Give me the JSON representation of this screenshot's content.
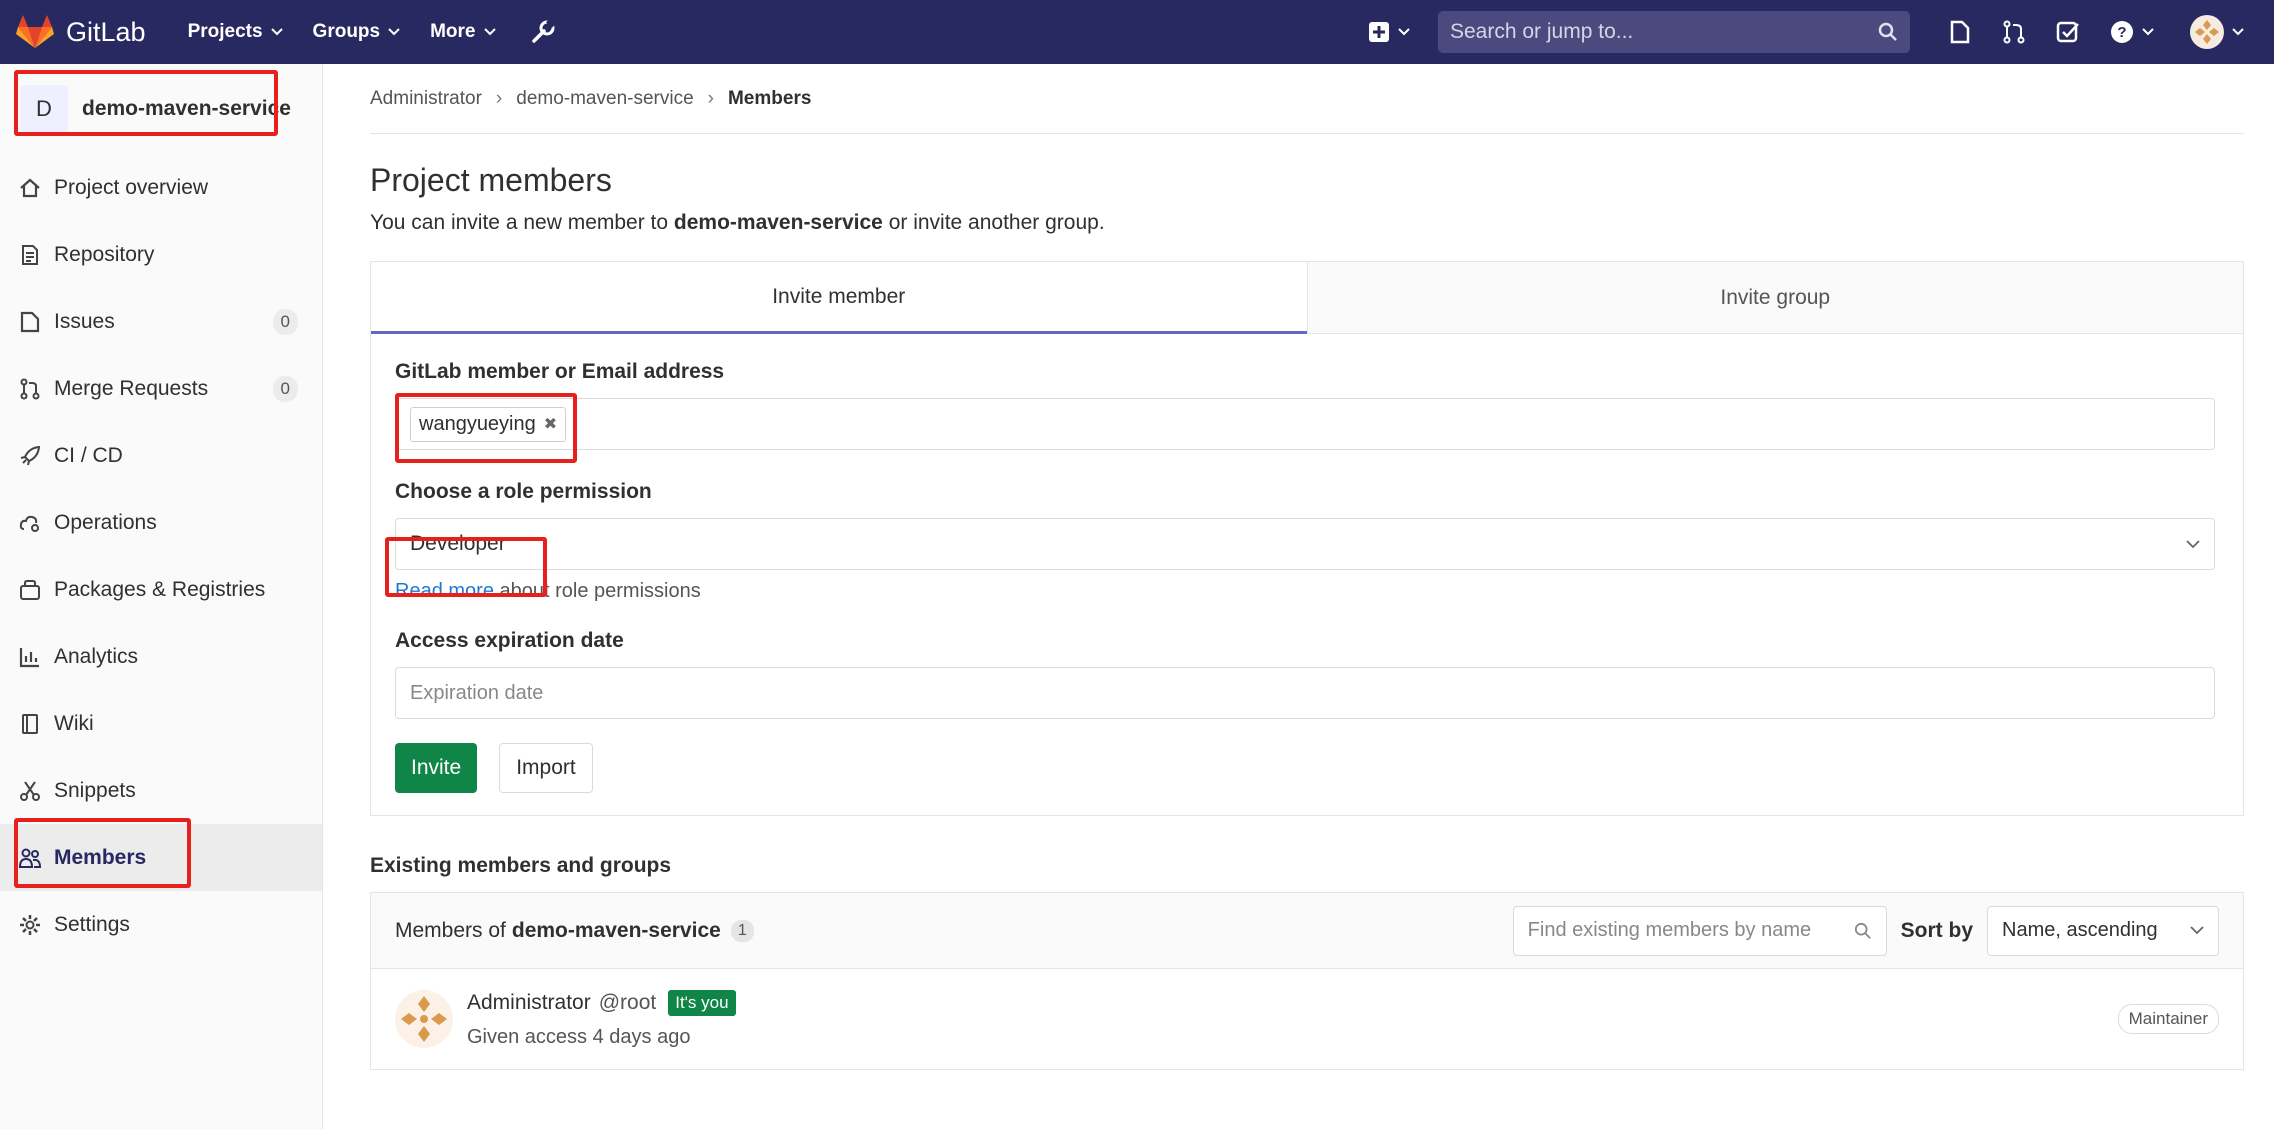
{
  "navbar": {
    "brand": "GitLab",
    "items": [
      {
        "label": "Projects"
      },
      {
        "label": "Groups"
      },
      {
        "label": "More"
      }
    ],
    "search_placeholder": "Search or jump to...",
    "colors": {
      "bg": "#292961",
      "accent": "#e24329"
    }
  },
  "sidebar": {
    "project_initial": "D",
    "project_name": "demo-maven-service",
    "items": [
      {
        "label": "Project overview",
        "icon": "home-icon"
      },
      {
        "label": "Repository",
        "icon": "doc-icon"
      },
      {
        "label": "Issues",
        "icon": "issues-icon",
        "count": "0"
      },
      {
        "label": "Merge Requests",
        "icon": "merge-request-icon",
        "count": "0"
      },
      {
        "label": "CI / CD",
        "icon": "rocket-icon"
      },
      {
        "label": "Operations",
        "icon": "cloud-gear-icon"
      },
      {
        "label": "Packages & Registries",
        "icon": "package-icon"
      },
      {
        "label": "Analytics",
        "icon": "chart-icon"
      },
      {
        "label": "Wiki",
        "icon": "book-icon"
      },
      {
        "label": "Snippets",
        "icon": "scissors-icon"
      },
      {
        "label": "Members",
        "icon": "users-icon"
      },
      {
        "label": "Settings",
        "icon": "gear-icon"
      }
    ]
  },
  "breadcrumb": [
    "Administrator",
    "demo-maven-service",
    "Members"
  ],
  "page": {
    "title": "Project members",
    "intro_prefix": "You can invite a new member to",
    "intro_project": "demo-maven-service",
    "intro_suffix": "or invite another group."
  },
  "tabs": [
    "Invite member",
    "Invite group"
  ],
  "form": {
    "member_label": "GitLab member or Email address",
    "member_token": "wangyueying",
    "role_label": "Choose a role permission",
    "role_value": "Developer",
    "help_link": "Read more",
    "help_text": "about role permissions",
    "expiry_label": "Access expiration date",
    "expiry_placeholder": "Expiration date",
    "invite_button": "Invite",
    "import_button": "Import"
  },
  "existing": {
    "title": "Existing members and groups",
    "members_of": "Members of",
    "project": "demo-maven-service",
    "count": "1",
    "find_placeholder": "Find existing members by name",
    "sort_label": "Sort by",
    "sort_value": "Name, ascending",
    "members": [
      {
        "name": "Administrator",
        "username": "@root",
        "badge": "It's you",
        "access": "Given access 4 days ago",
        "role": "Maintainer"
      }
    ]
  }
}
